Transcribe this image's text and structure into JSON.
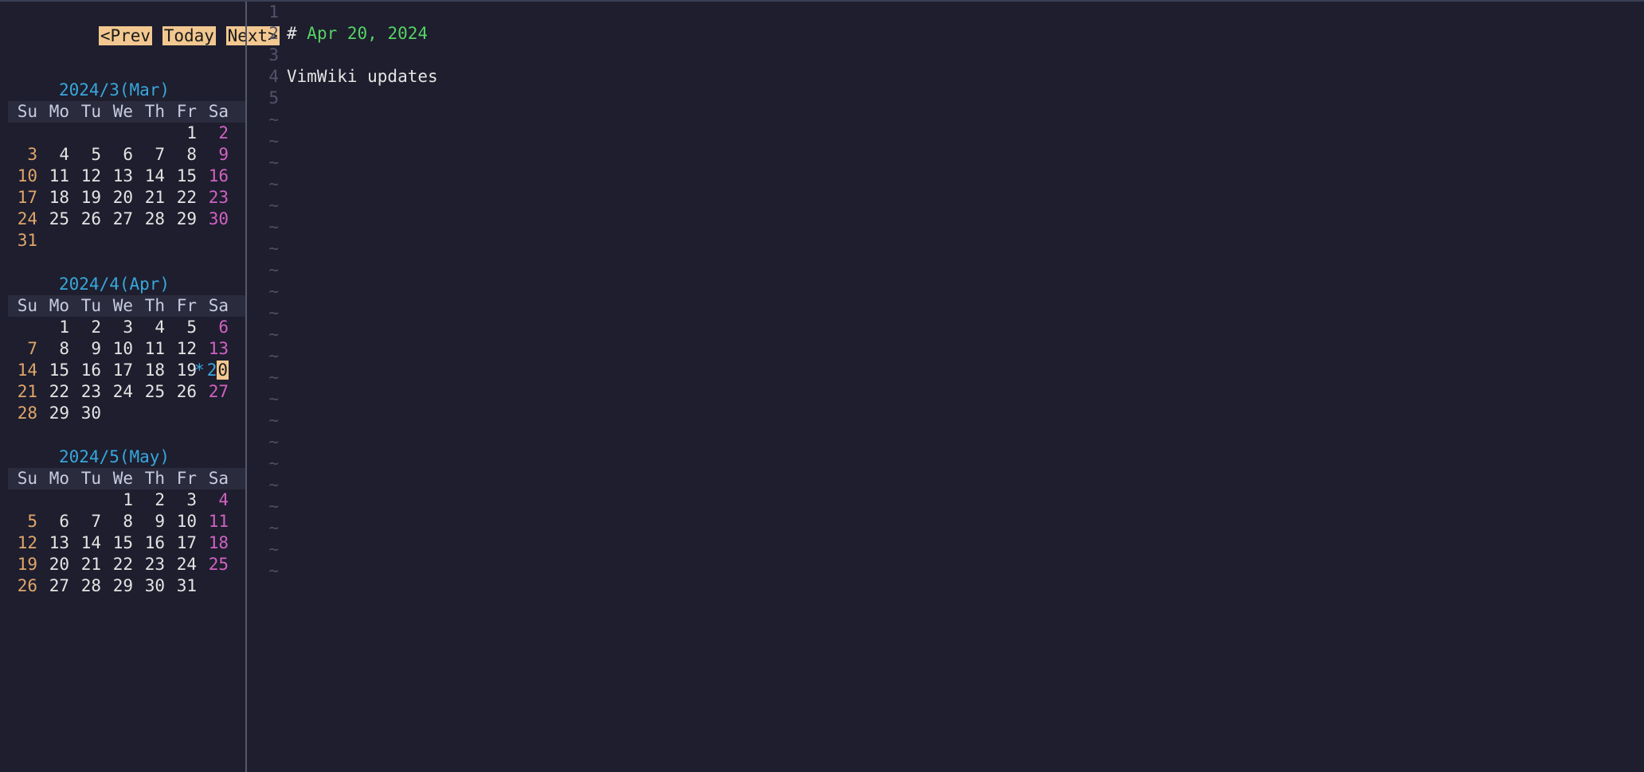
{
  "nav": {
    "prev": "<Prev",
    "today": "Today",
    "next": "Next>"
  },
  "dow": [
    "Su",
    "Mo",
    "Tu",
    "We",
    "Th",
    "Fr",
    "Sa"
  ],
  "months": [
    {
      "title": "2024/3(Mar)",
      "weeks": [
        [
          "",
          "",
          "",
          "",
          "",
          "1",
          "2"
        ],
        [
          "3",
          "4",
          "5",
          "6",
          "7",
          "8",
          "9"
        ],
        [
          "10",
          "11",
          "12",
          "13",
          "14",
          "15",
          "16"
        ],
        [
          "17",
          "18",
          "19",
          "20",
          "21",
          "22",
          "23"
        ],
        [
          "24",
          "25",
          "26",
          "27",
          "28",
          "29",
          "30"
        ],
        [
          "31",
          "",
          "",
          "",
          "",
          "",
          ""
        ]
      ]
    },
    {
      "title": "2024/4(Apr)",
      "today": "20",
      "weeks": [
        [
          "",
          "1",
          "2",
          "3",
          "4",
          "5",
          "6"
        ],
        [
          "7",
          "8",
          "9",
          "10",
          "11",
          "12",
          "13"
        ],
        [
          "14",
          "15",
          "16",
          "17",
          "18",
          "19",
          "20"
        ],
        [
          "21",
          "22",
          "23",
          "24",
          "25",
          "26",
          "27"
        ],
        [
          "28",
          "29",
          "30",
          "",
          "",
          "",
          ""
        ]
      ]
    },
    {
      "title": "2024/5(May)",
      "weeks": [
        [
          "",
          "",
          "",
          "1",
          "2",
          "3",
          "4"
        ],
        [
          "5",
          "6",
          "7",
          "8",
          "9",
          "10",
          "11"
        ],
        [
          "12",
          "13",
          "14",
          "15",
          "16",
          "17",
          "18"
        ],
        [
          "19",
          "20",
          "21",
          "22",
          "23",
          "24",
          "25"
        ],
        [
          "26",
          "27",
          "28",
          "29",
          "30",
          "31",
          ""
        ]
      ]
    }
  ],
  "editor": {
    "lines": [
      {
        "n": "1",
        "kind": "blank"
      },
      {
        "n": "2",
        "kind": "heading",
        "hash": "# ",
        "text": "Apr 20, 2024"
      },
      {
        "n": "3",
        "kind": "blank"
      },
      {
        "n": "4",
        "kind": "text",
        "text": "VimWiki updates"
      },
      {
        "n": "5",
        "kind": "blank"
      }
    ],
    "tilde_count": 22
  }
}
